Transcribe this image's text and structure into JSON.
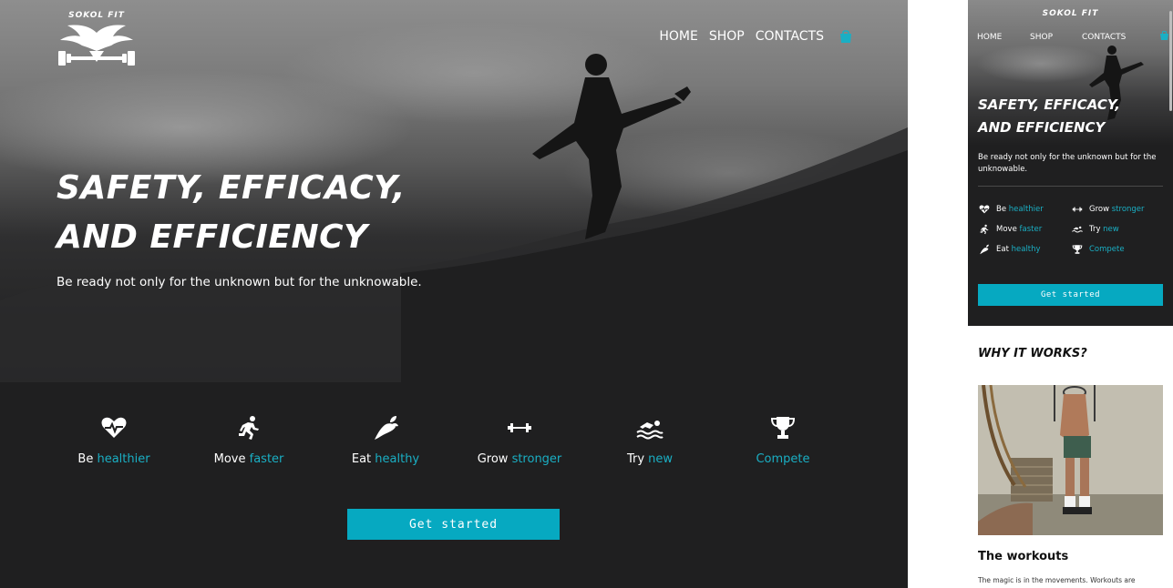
{
  "brand": {
    "name": "SOKOL FIT"
  },
  "nav": {
    "items": [
      {
        "label": "HOME"
      },
      {
        "label": "SHOP"
      },
      {
        "label": "CONTACTS"
      }
    ],
    "cart_icon": "shopping-bag-icon"
  },
  "hero": {
    "title_line1": "SAFETY, EFFICACY,",
    "title_line2": "AND EFFICIENCY",
    "subtitle": "Be ready not only for the unknown but for the unknowable."
  },
  "features": [
    {
      "prefix": "Be",
      "accent": "healthier",
      "icon": "heartbeat-icon"
    },
    {
      "prefix": "Move",
      "accent": "faster",
      "icon": "running-icon"
    },
    {
      "prefix": "Eat",
      "accent": "healthy",
      "icon": "carrot-icon"
    },
    {
      "prefix": "Grow",
      "accent": "stronger",
      "icon": "dumbbell-icon"
    },
    {
      "prefix": "Try",
      "accent": "new",
      "icon": "swimmer-icon"
    },
    {
      "prefix": "",
      "accent": "Compete",
      "icon": "trophy-icon"
    }
  ],
  "cta": {
    "label": "Get started"
  },
  "mobile": {
    "title_line1": "SAFETY, EFFICACY,",
    "title_line2": "AND EFFICIENCY",
    "subtitle": "Be ready not only for the unknown but for the unknowable.",
    "cta_label": "Get started",
    "why_title": "WHY IT WORKS?",
    "workouts_title": "The workouts",
    "workouts_text": "The magic is in the movements. Workouts are"
  },
  "colors": {
    "accent": "#06a9c1",
    "accent_text": "#1aafc4",
    "background_dark": "#1f1f20",
    "text_light": "#ffffff"
  }
}
